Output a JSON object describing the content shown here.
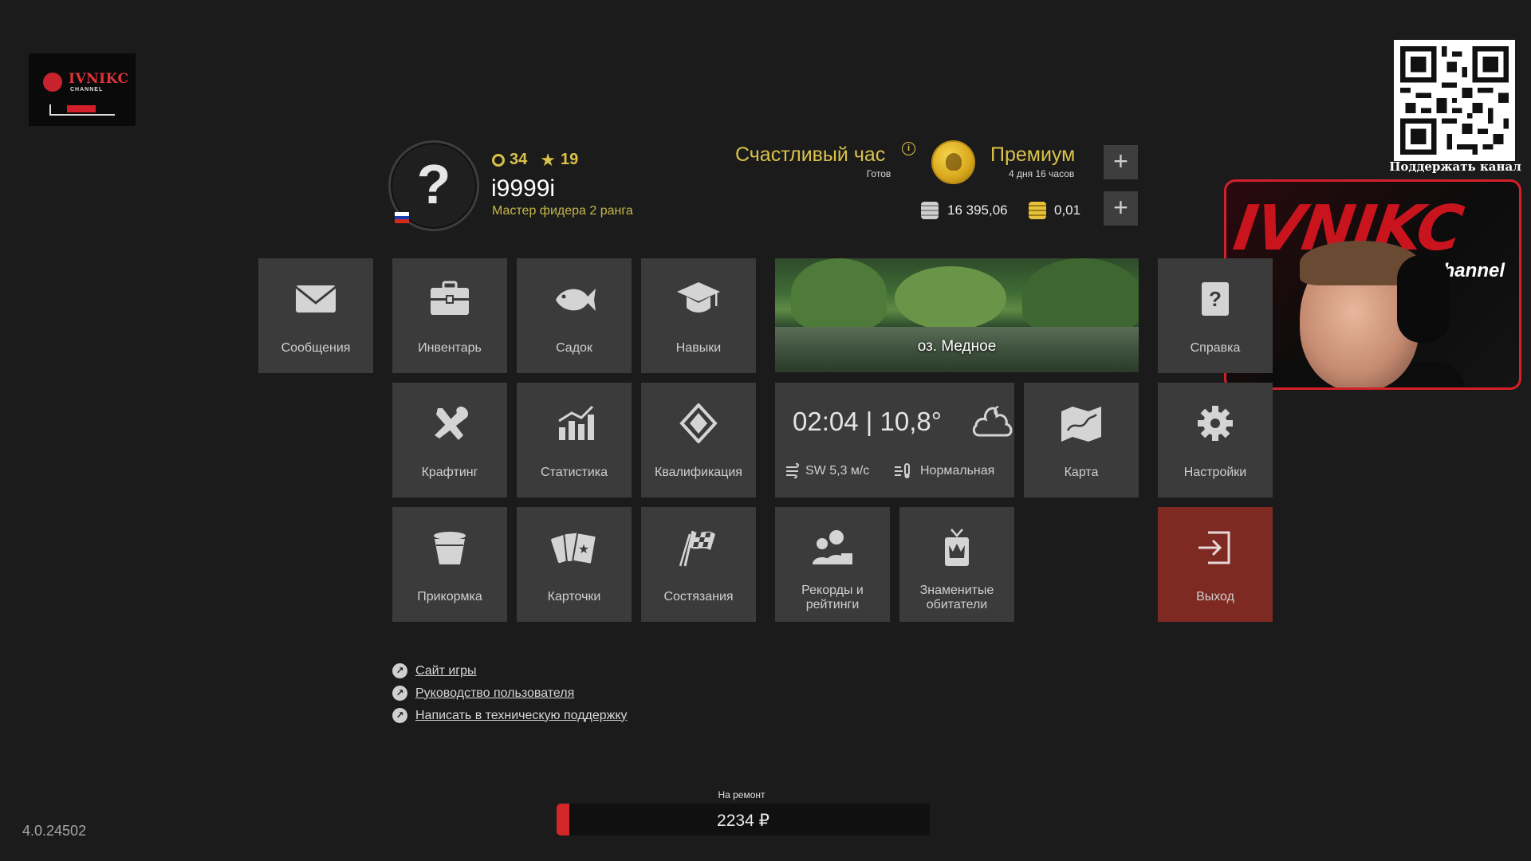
{
  "stream": {
    "logo_brand": "IVNIKC",
    "logo_sub": "CHANNEL",
    "qr_caption": "Поддержать канал",
    "cam_brand": "IVNIKC",
    "cam_channel": "channel"
  },
  "profile": {
    "avatar_glyph": "?",
    "level": "34",
    "stars": "19",
    "username": "i9999i",
    "rank": "Мастер фидера 2 ранга",
    "flag_colors": [
      "#ffffff",
      "#1c3fb0",
      "#d52b1e"
    ]
  },
  "bonus": {
    "happy_hour_label": "Счастливый час",
    "happy_hour_info": "i",
    "happy_hour_status": "Готов",
    "premium_label": "Премиум",
    "premium_time": "4 дня 16 часов",
    "plus": "+"
  },
  "currency": {
    "silver": "16 395,06",
    "gold": "0,01"
  },
  "tiles": {
    "messages": "Сообщения",
    "inventory": "Инвентарь",
    "keepnet": "Садок",
    "skills": "Навыки",
    "help": "Справка",
    "crafting": "Крафтинг",
    "statistics": "Статистика",
    "qualification": "Квалификация",
    "map": "Карта",
    "settings": "Настройки",
    "groundbait": "Прикормка",
    "cards": "Карточки",
    "competitions": "Состязания",
    "records_line1": "Рекорды и",
    "records_line2": "рейтинги",
    "trophies_line1": "Знаменитые",
    "trophies_line2": "обитатели",
    "exit": "Выход"
  },
  "location": {
    "lake_name": "оз. Медное"
  },
  "weather": {
    "time_temp": "02:04 | 10,8°",
    "wind": "SW  5,3 м/с",
    "pressure": "Нормальная"
  },
  "links": [
    {
      "label": "Сайт игры"
    },
    {
      "label": "Руководство пользователя"
    },
    {
      "label": "Написать в техническую поддержку"
    }
  ],
  "repair": {
    "label": "На ремонт",
    "value": "2234 ₽",
    "fill_fraction": 0.035
  },
  "version": "4.0.24502",
  "colors": {
    "accent_gold": "#d9c24a",
    "tile_bg": "#3b3b3b",
    "exit_bg": "#7e2a22",
    "brand_red": "#d3202a"
  }
}
